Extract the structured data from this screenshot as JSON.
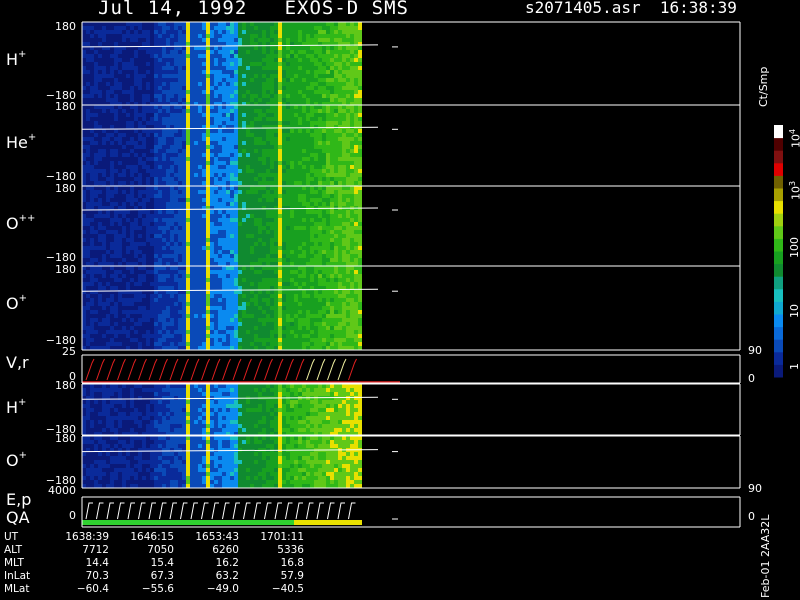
{
  "header": {
    "date": "Jul 14, 1992",
    "instrument": "EXOS-D SMS",
    "file": "s2071405.asr",
    "time": "16:38:39"
  },
  "colorbar": {
    "unit": "Ct/Smp",
    "labels": [
      "1",
      "10",
      "100",
      "10",
      "10"
    ],
    "exponents": [
      "",
      "",
      "",
      "3",
      "4"
    ],
    "colors": [
      "#0a1a7a",
      "#0a2a9a",
      "#0a4ab8",
      "#0a6ad8",
      "#0a8af0",
      "#10a8d0",
      "#18c0c0",
      "#10a080",
      "#108a30",
      "#18a020",
      "#30b818",
      "#60c818",
      "#a0d010",
      "#e8e000",
      "#a8a000",
      "#706000",
      "#e00000",
      "#801010",
      "#500000",
      "#ffffff"
    ]
  },
  "panels": [
    {
      "label": "H",
      "sup": "+",
      "top_tick": "180",
      "bottom_tick": "−180"
    },
    {
      "label": "He",
      "sup": "+",
      "top_tick": "180",
      "bottom_tick": "−180"
    },
    {
      "label": "O",
      "sup": "++",
      "top_tick": "180",
      "bottom_tick": "−180"
    },
    {
      "label": "O",
      "sup": "+",
      "top_tick": "180",
      "bottom_tick": "−180"
    },
    {
      "label": "V,r",
      "sup": "",
      "top_tick": "25",
      "bottom_tick": "0",
      "right_top": "90",
      "right_bottom": "0"
    },
    {
      "label": "H",
      "sup": "+",
      "top_tick": "180",
      "bottom_tick": "−180"
    },
    {
      "label": "O",
      "sup": "+",
      "top_tick": "180",
      "bottom_tick": "−180"
    },
    {
      "label": "E,p",
      "sup": "",
      "label2": "QA",
      "top_tick": "4000",
      "bottom_tick": "0",
      "right_top": "90",
      "right_bottom": "0"
    }
  ],
  "ephemeris": {
    "rows": [
      {
        "label": "UT",
        "values": [
          "1638:39",
          "1646:15",
          "1653:43",
          "1701:11"
        ]
      },
      {
        "label": "ALT",
        "values": [
          "7712",
          "7050",
          "6260",
          "5336"
        ]
      },
      {
        "label": "MLT",
        "values": [
          "14.4",
          "15.4",
          "16.2",
          "16.8"
        ]
      },
      {
        "label": "InLat",
        "values": [
          "70.3",
          "67.3",
          "63.2",
          "57.9"
        ]
      },
      {
        "label": "MLat",
        "values": [
          "−60.4",
          "−55.6",
          "−49.0",
          "−40.5"
        ]
      }
    ]
  },
  "datestamp": "Feb-01 2AA32L",
  "chart_data": {
    "type": "heatmap",
    "title": "Jul 14, 1992 EXOS-D SMS",
    "x": [
      "1638:39",
      "1646:15",
      "1653:43",
      "1701:11"
    ],
    "panels_ylim": [
      [
        -180,
        180
      ],
      [
        -180,
        180
      ],
      [
        -180,
        180
      ],
      [
        -180,
        180
      ],
      [
        0,
        25
      ],
      [
        -180,
        180
      ],
      [
        -180,
        180
      ],
      [
        0,
        4000
      ]
    ],
    "colorbar_range": [
      1,
      10000
    ],
    "scale": "log"
  }
}
